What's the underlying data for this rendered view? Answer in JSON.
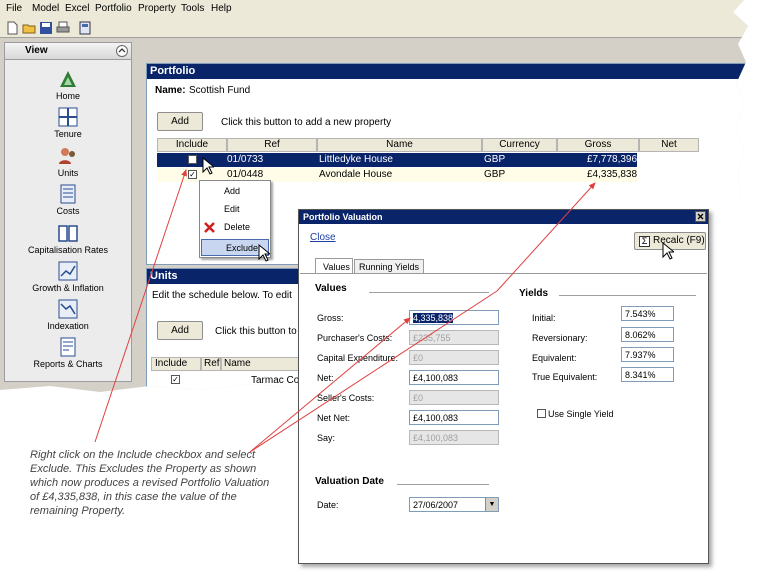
{
  "menu": [
    "File",
    "Model",
    "Excel",
    "Portfolio",
    "Property",
    "Tools",
    "Help"
  ],
  "nav": {
    "title": "View",
    "items": [
      "Home",
      "Tenure",
      "Units",
      "Costs",
      "Capitalisation Rates",
      "Growth & Inflation",
      "Indexation",
      "Reports & Charts"
    ]
  },
  "portfolio": {
    "title": "Portfolio",
    "name_label": "Name:",
    "name_value": "Scottish Fund",
    "add_label": "Add",
    "add_hint": "Click this button to add a new property",
    "columns": [
      "Include",
      "Ref",
      "Name",
      "Currency",
      "Gross",
      "Net"
    ],
    "rows": [
      {
        "ref": "01/0733",
        "name": "Littledyke House",
        "currency": "GBP",
        "gross": "£7,778,396"
      },
      {
        "ref": "01/0448",
        "name": "Avondale House",
        "currency": "GBP",
        "gross": "£4,335,838"
      }
    ]
  },
  "context_menu": [
    "Add",
    "Edit",
    "Delete",
    "Exclude"
  ],
  "units": {
    "title": "Units",
    "hint": "Edit the schedule below.  To edit",
    "add_label": "Add",
    "add_hint": "Click this button to",
    "columns": [
      "Include",
      "Ref",
      "Name"
    ],
    "row_text": "Tarmac Cor"
  },
  "valuation": {
    "title": "Portfolio Valuation",
    "close_label": "Close",
    "recalc_label": "Recalc (F9)",
    "tabs": [
      "Values",
      "Running Yields"
    ],
    "values_heading": "Values",
    "values": [
      {
        "label": "Gross:",
        "value": "4,335,838",
        "disabled": false
      },
      {
        "label": "Purchaser's Costs:",
        "value": "£235,755",
        "disabled": true
      },
      {
        "label": "Capital Expenditure:",
        "value": "£0",
        "disabled": true
      },
      {
        "label": "Net:",
        "value": "£4,100,083",
        "disabled": false
      },
      {
        "label": "Seller's Costs:",
        "value": "£0",
        "disabled": true
      },
      {
        "label": "Net Net:",
        "value": "£4,100,083",
        "disabled": false
      },
      {
        "label": "Say:",
        "value": "£4,100,083",
        "disabled": true
      }
    ],
    "yields_heading": "Yields",
    "yields": [
      {
        "label": "Initial:",
        "value": "7.543%"
      },
      {
        "label": "Reversionary:",
        "value": "8.062%"
      },
      {
        "label": "Equivalent:",
        "value": "7.937%"
      },
      {
        "label": "True Equivalent:",
        "value": "8.341%"
      }
    ],
    "single_yield_label": "Use Single Yield",
    "date_heading": "Valuation Date",
    "date_label": "Date:",
    "date_value": "27/06/2007"
  },
  "annotation": "Right click on the Include checkbox and select Exclude. This Excludes the Property as shown which now produces a revised Portfolio Valuation of £4,335,838, in this case the value of the remaining Property.",
  "colors": {
    "title_bar": "#0a246a",
    "selected_row": "#0a246a",
    "arrow": "#e04040"
  }
}
